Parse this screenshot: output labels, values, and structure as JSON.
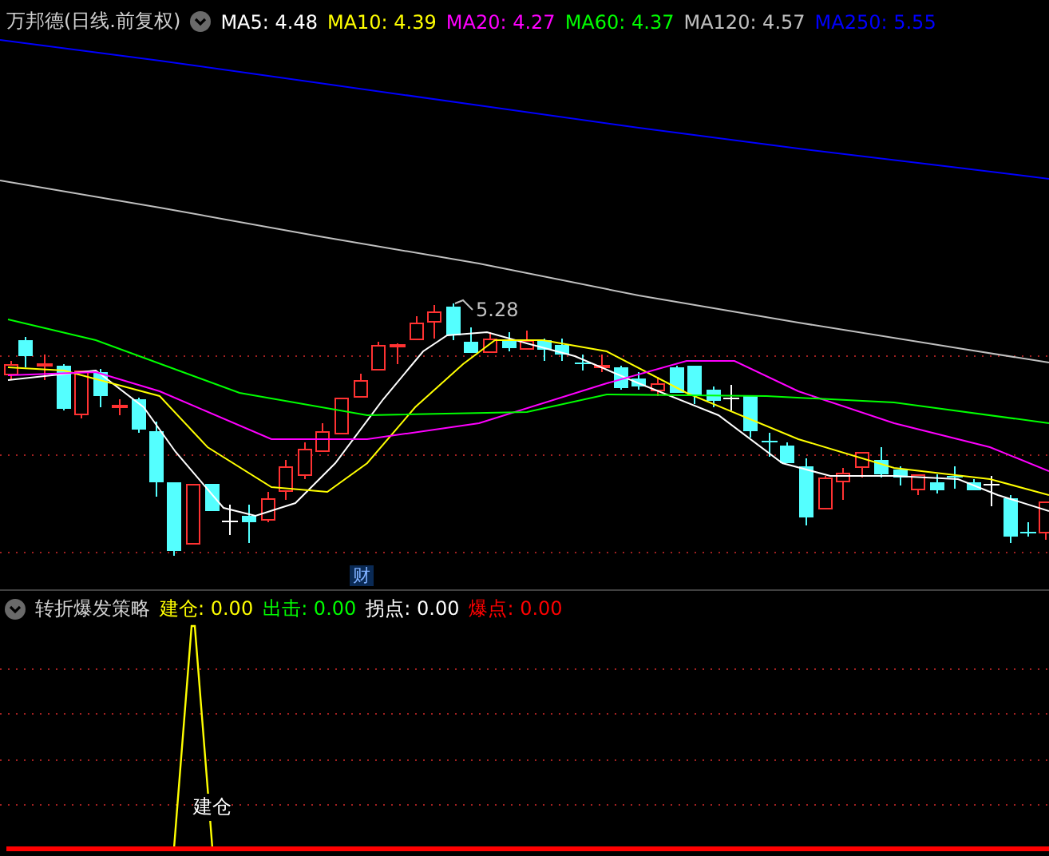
{
  "main_chart": {
    "title": "万邦德(日线.前复权)",
    "moving_averages": [
      {
        "label": "MA5: 4.48",
        "color": "#ffffff"
      },
      {
        "label": "MA10: 4.39",
        "color": "#ffff00"
      },
      {
        "label": "MA20: 4.27",
        "color": "#ff00ff"
      },
      {
        "label": "MA60: 4.37",
        "color": "#00ff00"
      },
      {
        "label": "MA120: 4.57",
        "color": "#c0c0c0"
      },
      {
        "label": "MA250: 5.55",
        "color": "#0000ff"
      }
    ],
    "high_annotation": "5.28",
    "event_marker": "财"
  },
  "indicator_panel": {
    "title": "转折爆发策略",
    "values": [
      {
        "label": "建仓: 0.00",
        "color": "#ffff00"
      },
      {
        "label": "出击: 0.00",
        "color": "#00ff00"
      },
      {
        "label": "拐点: 0.00",
        "color": "#ffffff"
      },
      {
        "label": "爆点: 0.00",
        "color": "#ff0000"
      }
    ],
    "signal_label": "建仓"
  }
}
